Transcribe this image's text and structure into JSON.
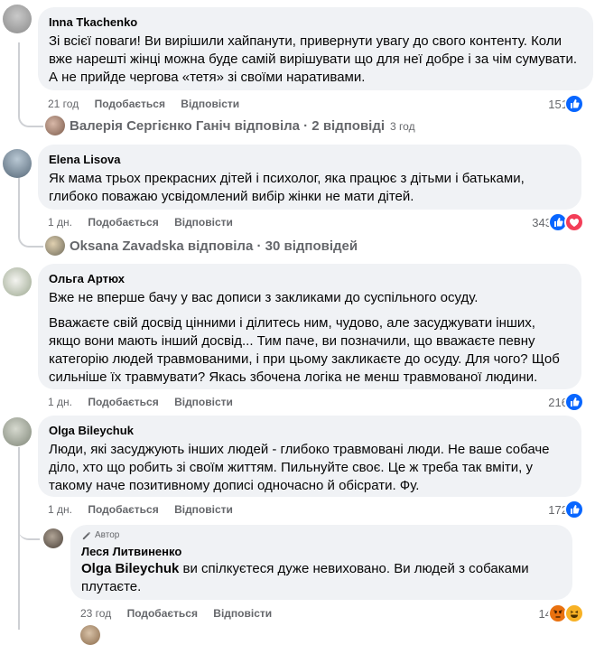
{
  "comments": [
    {
      "author": "Inna Tkachenko",
      "paragraphs": [
        "Зі всієї поваги! Ви вирішили хайпанути, привернути увагу до свого контенту. Коли вже нарешті жінці можна буде самій вирішувати що для неї добре і за чім сумувати. А не прийде чергова «тетя» зі своїми наративами."
      ],
      "time": "21 год",
      "like_label": "Подобається",
      "reply_label": "Відповісти",
      "reaction_count": "151",
      "reactions": [
        "like"
      ],
      "replies_summary": "Валерія Сергієнко Ганіч відповіла · 2 відповіді",
      "replies_time": "3 год"
    },
    {
      "author": "Elena Lisova",
      "paragraphs": [
        "Як мама трьох прекрасних дітей і психолог, яка працює з дітьми і батьками, глибоко поважаю усвідомлений вибір жінки не мати дітей."
      ],
      "time": "1 дн.",
      "like_label": "Подобається",
      "reply_label": "Відповісти",
      "reaction_count": "343",
      "reactions": [
        "like",
        "love"
      ],
      "replies_summary": "Oksana Zavadska відповіла · 30 відповідей",
      "replies_time": ""
    },
    {
      "author": "Ольга Артюх",
      "paragraphs": [
        "Вже не вперше бачу у вас дописи з закликами до суспільного осуду.",
        "Вважаєте свій досвід цінними і ділитесь ним, чудово, але засуджувати інших, якщо вони мають інший досвід... Тим паче, ви позначили, що вважаєте певну категорію людей травмованими, і при цьому закликаєте до осуду. Для чого? Щоб сильніше їх травмувати? Якась збочена логіка не менш травмованої людини."
      ],
      "time": "1 дн.",
      "like_label": "Подобається",
      "reply_label": "Відповісти",
      "reaction_count": "216",
      "reactions": [
        "like"
      ]
    },
    {
      "author": "Olga Bileychuk",
      "paragraphs": [
        "Люди, які засуджують інших людей - глибоко травмовані люди. Не ваше собаче діло, хто що робить зі своїм життям. Пильнуйте своє. Це ж треба так вміти, у такому наче позитивному дописі одночасно й обісрати. Фу."
      ],
      "time": "1 дн.",
      "like_label": "Подобається",
      "reply_label": "Відповісти",
      "reaction_count": "172",
      "reactions": [
        "like"
      ]
    }
  ],
  "reply": {
    "badge": "Автор",
    "author": "Леся Литвиненко",
    "mention": "Olga Bileychuk",
    "text": " ви спілкуєтеся дуже невиховано. Ви людей з собаками плутаєте.",
    "time": "23 год",
    "like_label": "Подобається",
    "reply_label": "Відповісти",
    "reaction_count": "14",
    "reactions": [
      "angry",
      "haha"
    ]
  },
  "colors": {
    "bubble": "#f0f2f5",
    "secondary_text": "#65676b",
    "like_blue": "#0866ff",
    "love_red": "#f33e58",
    "angry_orange": "#e9710f",
    "haha_yellow": "#f7b125"
  }
}
